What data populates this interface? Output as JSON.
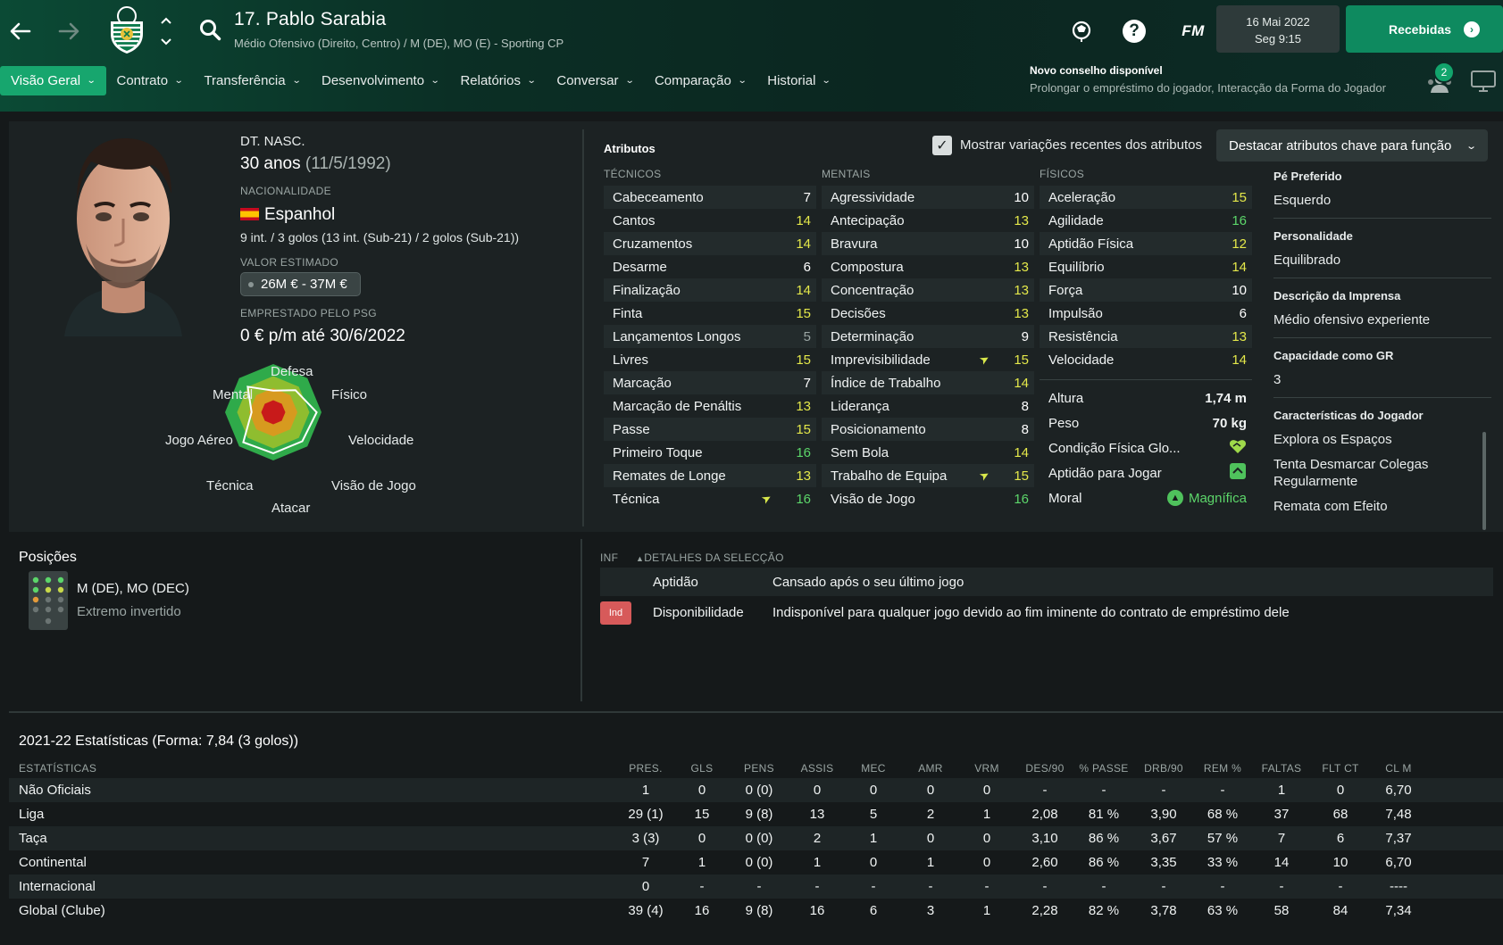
{
  "header": {
    "player_name": "17. Pablo Sarabia",
    "player_subtitle": "Médio Ofensivo (Direito, Centro) / M (DE), MO (E) - Sporting CP",
    "fm_logo": "FM",
    "date_line1": "16 Mai 2022",
    "date_line2": "Seg 9:15",
    "inbox_label": "Recebidas",
    "tabs": [
      {
        "label": "Visão Geral",
        "active": true
      },
      {
        "label": "Contrato"
      },
      {
        "label": "Transferência"
      },
      {
        "label": "Desenvolvimento"
      },
      {
        "label": "Relatórios"
      },
      {
        "label": "Conversar"
      },
      {
        "label": "Comparação"
      },
      {
        "label": "Historial"
      }
    ],
    "advice_title": "Novo conselho disponível",
    "advice_text": "Prolongar o empréstimo do jogador, Interacção da Forma do Jogador",
    "notification_count": "2",
    "accent_color": "#17a66e"
  },
  "profile": {
    "dob_label": "DT. NASC.",
    "age": "30 anos",
    "dob": "(11/5/1992)",
    "nationality_label": "NACIONALIDADE",
    "nationality": "Espanhol",
    "caps": "9 int. / 3 golos (13 int. (Sub-21) / 2 golos (Sub-21))",
    "value_label": "VALOR ESTIMADO",
    "value": "26M € - 37M €",
    "loan_label": "EMPRESTADO PELO PSG",
    "loan_value": "0 € p/m até 30/6/2022"
  },
  "radar": {
    "labels": {
      "defesa": "Defesa",
      "fisico": "Físico",
      "velocidade": "Velocidade",
      "visao": "Visão de Jogo",
      "atacar": "Atacar",
      "tecnica": "Técnica",
      "aereo": "Jogo Aéreo",
      "mental": "Mental"
    },
    "values": [
      0.45,
      0.65,
      0.9,
      0.85,
      0.85,
      0.88,
      0.45,
      0.75
    ]
  },
  "attributes": {
    "title": "Atributos",
    "show_changes_label": "Mostrar variações recentes dos atributos",
    "highlight_dropdown": "Destacar atributos chave para função",
    "technical_title": "TÉCNICOS",
    "mental_title": "MENTAIS",
    "physical_title": "FÍSICOS",
    "technical": [
      {
        "name": "Cabeceamento",
        "value": "7",
        "tier": "white"
      },
      {
        "name": "Cantos",
        "value": "14",
        "tier": "yellow"
      },
      {
        "name": "Cruzamentos",
        "value": "14",
        "tier": "yellow"
      },
      {
        "name": "Desarme",
        "value": "6",
        "tier": "white"
      },
      {
        "name": "Finalização",
        "value": "14",
        "tier": "yellow"
      },
      {
        "name": "Finta",
        "value": "15",
        "tier": "yellow"
      },
      {
        "name": "Lançamentos Longos",
        "value": "5",
        "tier": "grey"
      },
      {
        "name": "Livres",
        "value": "15",
        "tier": "yellow"
      },
      {
        "name": "Marcação",
        "value": "7",
        "tier": "white"
      },
      {
        "name": "Marcação de Penáltis",
        "value": "13",
        "tier": "yellow"
      },
      {
        "name": "Passe",
        "value": "15",
        "tier": "yellow"
      },
      {
        "name": "Primeiro Toque",
        "value": "16",
        "tier": "green"
      },
      {
        "name": "Remates de Longe",
        "value": "13",
        "tier": "yellow"
      },
      {
        "name": "Técnica",
        "value": "16",
        "tier": "green",
        "arrow": true
      }
    ],
    "mental": [
      {
        "name": "Agressividade",
        "value": "10",
        "tier": "white"
      },
      {
        "name": "Antecipação",
        "value": "13",
        "tier": "yellow"
      },
      {
        "name": "Bravura",
        "value": "10",
        "tier": "white"
      },
      {
        "name": "Compostura",
        "value": "13",
        "tier": "yellow"
      },
      {
        "name": "Concentração",
        "value": "13",
        "tier": "yellow"
      },
      {
        "name": "Decisões",
        "value": "13",
        "tier": "yellow"
      },
      {
        "name": "Determinação",
        "value": "9",
        "tier": "white"
      },
      {
        "name": "Imprevisibilidade",
        "value": "15",
        "tier": "yellow",
        "arrow": true
      },
      {
        "name": "Índice de Trabalho",
        "value": "14",
        "tier": "yellow"
      },
      {
        "name": "Liderança",
        "value": "8",
        "tier": "white"
      },
      {
        "name": "Posicionamento",
        "value": "8",
        "tier": "white"
      },
      {
        "name": "Sem Bola",
        "value": "14",
        "tier": "yellow"
      },
      {
        "name": "Trabalho de Equipa",
        "value": "15",
        "tier": "yellow",
        "arrow": true
      },
      {
        "name": "Visão de Jogo",
        "value": "16",
        "tier": "green"
      }
    ],
    "physical": [
      {
        "name": "Aceleração",
        "value": "15",
        "tier": "yellow"
      },
      {
        "name": "Agilidade",
        "value": "16",
        "tier": "green"
      },
      {
        "name": "Aptidão Física",
        "value": "12",
        "tier": "yellow"
      },
      {
        "name": "Equilíbrio",
        "value": "14",
        "tier": "yellow"
      },
      {
        "name": "Força",
        "value": "10",
        "tier": "white"
      },
      {
        "name": "Impulsão",
        "value": "6",
        "tier": "white"
      },
      {
        "name": "Resistência",
        "value": "13",
        "tier": "yellow"
      },
      {
        "name": "Velocidade",
        "value": "14",
        "tier": "yellow"
      }
    ],
    "height_label": "Altura",
    "height": "1,74 m",
    "weight_label": "Peso",
    "weight": "70 kg",
    "condition_label": "Condição Física Glo...",
    "match_fitness_label": "Aptidão para Jogar",
    "morale_label": "Moral",
    "morale": "Magnífica"
  },
  "side_info": {
    "foot_label": "Pé Preferido",
    "foot": "Esquerdo",
    "personality_label": "Personalidade",
    "personality": "Equilibrado",
    "media_label": "Descrição da Imprensa",
    "media": "Médio ofensivo experiente",
    "gk_label": "Capacidade como GR",
    "gk": "3",
    "traits_label": "Características do Jogador",
    "traits": [
      "Explora os Espaços",
      "Tenta Desmarcar Colegas Regularmente",
      "Remata com Efeito"
    ]
  },
  "positions": {
    "title": "Posições",
    "main": "M (DE), MO (DEC)",
    "role": "Extremo invertido"
  },
  "selection": {
    "inf_label": "INF",
    "details_label": "DETALHES DA SELECÇÃO",
    "rows": [
      {
        "label": "Aptidão",
        "text": "Cansado após o seu último jogo"
      },
      {
        "label": "Disponibilidade",
        "text": "Indisponível para qualquer jogo devido ao fim iminente do contrato de empréstimo dele",
        "badge": "Ind"
      }
    ]
  },
  "stats": {
    "title": "2021-22 Estatísticas (Forma: 7,84 (3 golos))",
    "headers": [
      "ESTATÍSTICAS",
      "PRES.",
      "GLS",
      "PENS",
      "ASSIS",
      "MEC",
      "AMR",
      "VRM",
      "DES/90",
      "% PASSE",
      "DRB/90",
      "REM %",
      "FALTAS",
      "FLT CT",
      "CL M"
    ],
    "rows": [
      [
        "Não Oficiais",
        "1",
        "0",
        "0 (0)",
        "0",
        "0",
        "0",
        "0",
        "-",
        "-",
        "-",
        "-",
        "1",
        "0",
        "6,70"
      ],
      [
        "Liga",
        "29 (1)",
        "15",
        "9 (8)",
        "13",
        "5",
        "2",
        "1",
        "2,08",
        "81 %",
        "3,90",
        "68 %",
        "37",
        "68",
        "7,48"
      ],
      [
        "Taça",
        "3 (3)",
        "0",
        "0 (0)",
        "2",
        "1",
        "0",
        "0",
        "3,10",
        "86 %",
        "3,67",
        "57 %",
        "7",
        "6",
        "7,37"
      ],
      [
        "Continental",
        "7",
        "1",
        "0 (0)",
        "1",
        "0",
        "1",
        "0",
        "2,60",
        "86 %",
        "3,35",
        "33 %",
        "14",
        "10",
        "6,70"
      ],
      [
        "Internacional",
        "0",
        "-",
        "-",
        "-",
        "-",
        "-",
        "-",
        "-",
        "-",
        "-",
        "-",
        "-",
        "-",
        "----"
      ],
      [
        "Global (Clube)",
        "39 (4)",
        "16",
        "9 (8)",
        "16",
        "6",
        "3",
        "1",
        "2,28",
        "82 %",
        "3,78",
        "63 %",
        "58",
        "84",
        "7,34"
      ]
    ]
  }
}
